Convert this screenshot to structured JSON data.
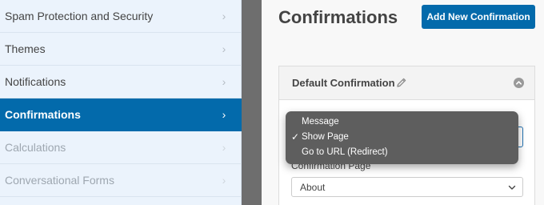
{
  "sidebar": {
    "items": [
      {
        "label": "Spam Protection and Security",
        "state": "normal"
      },
      {
        "label": "Themes",
        "state": "normal"
      },
      {
        "label": "Notifications",
        "state": "normal"
      },
      {
        "label": "Confirmations",
        "state": "active"
      },
      {
        "label": "Calculations",
        "state": "disabled"
      },
      {
        "label": "Conversational Forms",
        "state": "disabled"
      }
    ],
    "chevron": "›"
  },
  "header": {
    "title": "Confirmations",
    "add_button": "Add New Confirmation"
  },
  "panel": {
    "title": "Default Confirmation",
    "edit_icon": "pencil-icon",
    "collapse_icon": "chevron-up-circle-icon",
    "confirmation_type": {
      "options": [
        "Message",
        "Show Page",
        "Go to URL (Redirect)"
      ],
      "selected": "Show Page",
      "check": "✓"
    },
    "page_field": {
      "label": "Confirmation Page",
      "value": "About"
    }
  },
  "colors": {
    "accent": "#036aab",
    "sidebar_bg": "#ebf3fc",
    "dropdown_bg": "#5e5e5e"
  }
}
